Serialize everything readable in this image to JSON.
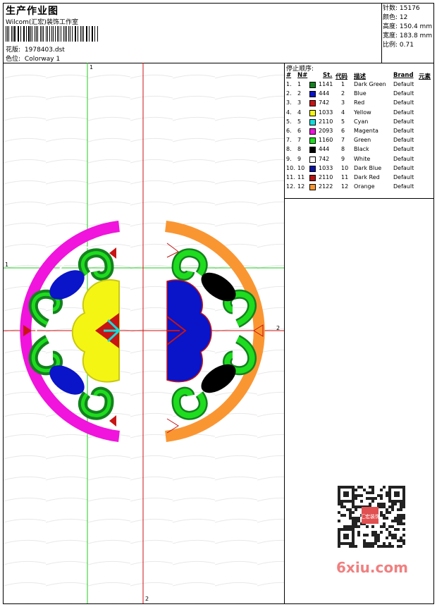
{
  "header": {
    "title": "生产作业图",
    "studio": "Wilcom(汇宏)装饰工作室",
    "design_label": "花版:",
    "design_value": "1978403.dst",
    "colorway_label": "色位:",
    "colorway_value": "Colorway 1"
  },
  "stats": [
    {
      "label": "针数:",
      "value": "15176"
    },
    {
      "label": "颜色:",
      "value": "12"
    },
    {
      "label": "高度:",
      "value": "150.4 mm"
    },
    {
      "label": "宽度:",
      "value": "183.8 mm"
    },
    {
      "label": "比例:",
      "value": "0.71"
    }
  ],
  "stop_sequence": {
    "title": "停止顺序:",
    "columns": [
      "#",
      "N#",
      "St.",
      "代码",
      "描述",
      "Brand",
      "元素"
    ],
    "rows": [
      {
        "idx": "1.",
        "n": "1",
        "color": "#13821e",
        "st": "1141",
        "code": "1",
        "desc": "Dark Green",
        "brand": "Default"
      },
      {
        "idx": "2.",
        "n": "2",
        "color": "#0a14c8",
        "st": "444",
        "code": "2",
        "desc": "Blue",
        "brand": "Default"
      },
      {
        "idx": "3.",
        "n": "3",
        "color": "#c81414",
        "st": "742",
        "code": "3",
        "desc": "Red",
        "brand": "Default"
      },
      {
        "idx": "4.",
        "n": "4",
        "color": "#f5f514",
        "st": "1033",
        "code": "4",
        "desc": "Yellow",
        "brand": "Default"
      },
      {
        "idx": "5.",
        "n": "5",
        "color": "#14dcdc",
        "st": "2110",
        "code": "5",
        "desc": "Cyan",
        "brand": "Default"
      },
      {
        "idx": "6.",
        "n": "6",
        "color": "#f014dc",
        "st": "2093",
        "code": "6",
        "desc": "Magenta",
        "brand": "Default"
      },
      {
        "idx": "7.",
        "n": "7",
        "color": "#1edc1e",
        "st": "1160",
        "code": "7",
        "desc": "Green",
        "brand": "Default"
      },
      {
        "idx": "8.",
        "n": "8",
        "color": "#000000",
        "st": "444",
        "code": "8",
        "desc": "Black",
        "brand": "Default"
      },
      {
        "idx": "9.",
        "n": "9",
        "color": "#ffffff",
        "st": "742",
        "code": "9",
        "desc": "White",
        "brand": "Default"
      },
      {
        "idx": "10.",
        "n": "10",
        "color": "#0a14a0",
        "st": "1033",
        "code": "10",
        "desc": "Dark Blue",
        "brand": "Default"
      },
      {
        "idx": "11.",
        "n": "11",
        "color": "#b41414",
        "st": "2110",
        "code": "11",
        "desc": "Dark Red",
        "brand": "Default"
      },
      {
        "idx": "12.",
        "n": "12",
        "color": "#fa9632",
        "st": "2122",
        "code": "12",
        "desc": "Orange",
        "brand": "Default"
      }
    ]
  },
  "canvas": {
    "marker_v1": "1",
    "marker_h1": "1",
    "marker_h2": "2",
    "marker_v2": "2"
  },
  "watermark": {
    "text": "6xiu.com",
    "qr_stamp": "汇宏装饰"
  }
}
